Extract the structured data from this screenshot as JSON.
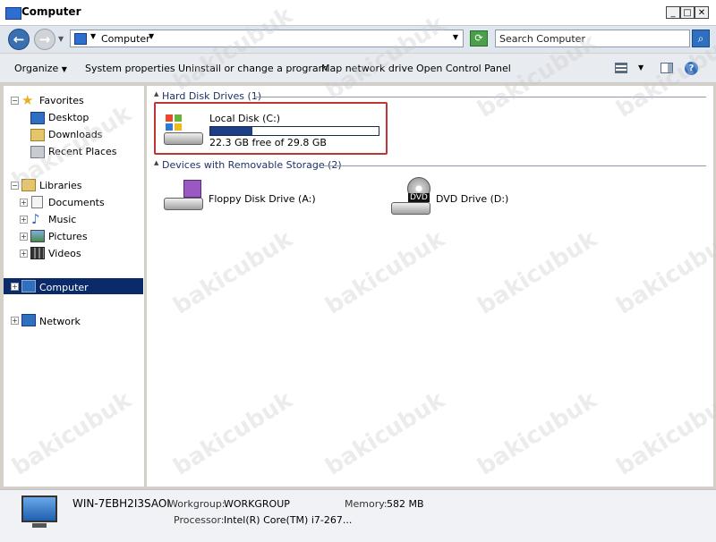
{
  "window": {
    "title": "Computer"
  },
  "address": {
    "location": "Computer",
    "search_placeholder": "Search Computer"
  },
  "toolbar": {
    "organize": "Organize",
    "system_properties": "System properties",
    "uninstall": "Uninstall or change a program",
    "map_drive": "Map network drive",
    "control_panel": "Open Control Panel"
  },
  "nav": {
    "favorites": "Favorites",
    "desktop": "Desktop",
    "downloads": "Downloads",
    "recent": "Recent Places",
    "libraries": "Libraries",
    "documents": "Documents",
    "music": "Music",
    "pictures": "Pictures",
    "videos": "Videos",
    "computer": "Computer",
    "network": "Network"
  },
  "content": {
    "hdd_group": "Hard Disk Drives (1)",
    "removable_group": "Devices with Removable Storage (2)",
    "local_disk": {
      "name": "Local Disk (C:)",
      "free": "22.3 GB free of 29.8 GB",
      "used_fraction": 0.25
    },
    "floppy": "Floppy Disk Drive (A:)",
    "dvd": "DVD Drive (D:)",
    "dvd_badge": "DVD"
  },
  "status": {
    "computer_name": "WIN-7EBH2I3SAOI",
    "workgroup_label": "Workgroup:",
    "workgroup": "WORKGROUP",
    "memory_label": "Memory:",
    "memory": "582 MB",
    "processor_label": "Processor:",
    "processor": "Intel(R) Core(TM) i7-267..."
  },
  "watermark": "bakicubuk",
  "colors": {
    "selection": "#0a2a6a",
    "highlight_box": "#c03434",
    "bar_fill": "#1e3f88"
  }
}
